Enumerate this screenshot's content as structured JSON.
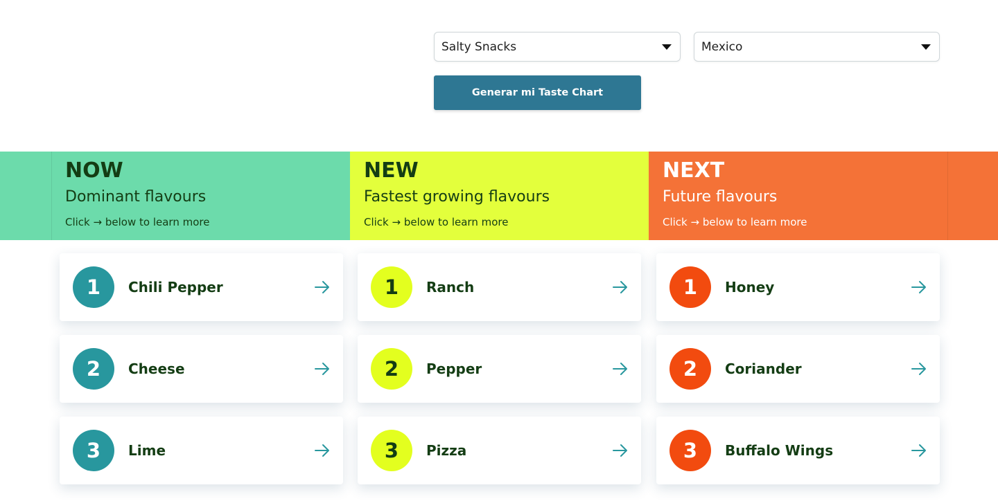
{
  "filters": {
    "category": {
      "value": "Salty Snacks"
    },
    "country": {
      "value": "Mexico"
    },
    "generate_label": "Generar mi Taste Chart"
  },
  "colors": {
    "now": "#6cdbab",
    "new": "#e3ff3c",
    "next": "#f47237",
    "button": "#2e7793",
    "arrow": "#28979e"
  },
  "columns": [
    {
      "title": "NOW",
      "subtitle": "Dominant flavours",
      "hint_prefix": "Click",
      "hint_suffix": "below to learn more",
      "items": [
        {
          "rank": "1",
          "name": "Chili Pepper"
        },
        {
          "rank": "2",
          "name": "Cheese"
        },
        {
          "rank": "3",
          "name": "Lime"
        }
      ]
    },
    {
      "title": "NEW",
      "subtitle": "Fastest growing flavours",
      "hint_prefix": "Click",
      "hint_suffix": "below to learn more",
      "items": [
        {
          "rank": "1",
          "name": "Ranch"
        },
        {
          "rank": "2",
          "name": "Pepper"
        },
        {
          "rank": "3",
          "name": "Pizza"
        }
      ]
    },
    {
      "title": "NEXT",
      "subtitle": "Future flavours",
      "hint_prefix": "Click",
      "hint_suffix": "below to learn more",
      "items": [
        {
          "rank": "1",
          "name": "Honey"
        },
        {
          "rank": "2",
          "name": "Coriander"
        },
        {
          "rank": "3",
          "name": "Buffalo Wings"
        }
      ]
    }
  ]
}
